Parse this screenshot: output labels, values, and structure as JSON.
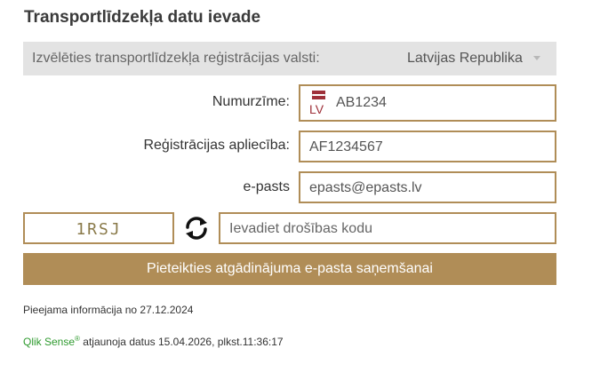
{
  "page": {
    "title": "Transportlīdzekļa datu ievade"
  },
  "country": {
    "label": "Izvēlēties transportlīdzekļa reģistrācijas valsti:",
    "selected": "Latvijas Republika"
  },
  "fields": {
    "plate_label": "Numurzīme:",
    "plate_country_code": "LV",
    "plate_value": "AB1234",
    "registration_label": "Reģistrācijas apliecība:",
    "registration_value": "AF1234567",
    "email_label": "e-pasts",
    "email_value": "epasts@epasts.lv"
  },
  "captcha": {
    "text": "1RSJ",
    "refresh_icon": "refresh-icon",
    "code_placeholder": "Ievadiet drošības kodu"
  },
  "submit": {
    "label": "Pieteikties atgādinājuma e-pasta saņemšanai"
  },
  "info": {
    "availability": "Pieejama informācija no 27.12.2024",
    "brand": "Qlik Sense",
    "brand_mark": "®",
    "update_text": " atjaunoja datus 15.04.2026, plkst.11:36:17"
  },
  "colors": {
    "accent": "#b08d57",
    "flag_red": "#9e3039",
    "brand_green": "#2e9a2e",
    "bar_bg": "#e3e3e3"
  }
}
